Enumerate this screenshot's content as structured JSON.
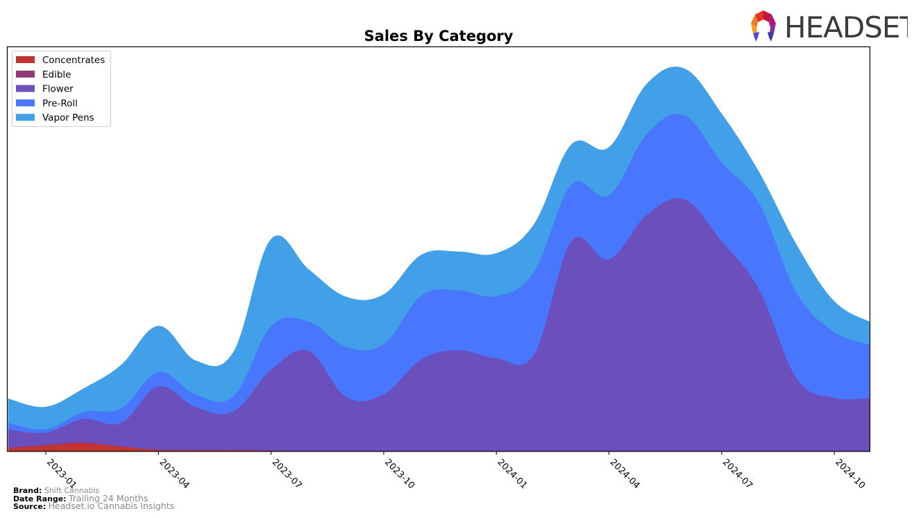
{
  "brand_logo": {
    "text": "HEADSET",
    "icon": "headset-hexagon-logo-icon"
  },
  "footer": {
    "brand_label": "Brand:",
    "brand_value": "Shift Cannabis",
    "date_range_label": "Date Range:",
    "date_range_value": "Trailing 24 Months",
    "source_label": "Source:",
    "source_value": "Headset.io Cannabis Insights"
  },
  "chart_data": {
    "type": "area",
    "stacked": true,
    "title": "Sales By Category",
    "xlabel": "",
    "ylabel": "",
    "y_axis_visible": false,
    "grid": false,
    "legend_position": "top-left",
    "x": [
      "2022-12",
      "2023-01",
      "2023-02",
      "2023-03",
      "2023-04",
      "2023-05",
      "2023-06",
      "2023-07",
      "2023-08",
      "2023-09",
      "2023-10",
      "2023-11",
      "2023-12",
      "2024-01",
      "2024-02",
      "2024-03",
      "2024-04",
      "2024-05",
      "2024-06",
      "2024-07",
      "2024-08",
      "2024-09",
      "2024-10",
      "2024-11"
    ],
    "x_ticks": [
      "2023-01",
      "2023-04",
      "2023-07",
      "2023-10",
      "2024-01",
      "2024-04",
      "2024-07",
      "2024-10"
    ],
    "ylim": [
      0,
      100
    ],
    "series": [
      {
        "name": "Concentrates",
        "color": "#c23431",
        "values": [
          0.8,
          1.5,
          2.1,
          1.2,
          0.4,
          0.3,
          0.3,
          0.2,
          0.1,
          0.1,
          0.1,
          0.1,
          0.1,
          0.1,
          0.1,
          0.1,
          0.1,
          0.1,
          0.1,
          0.1,
          0.1,
          0.1,
          0.1,
          0.1
        ]
      },
      {
        "name": "Edible",
        "color": "#8e3b78",
        "values": [
          0.2,
          0.2,
          0.2,
          0.1,
          0.1,
          0.1,
          0.1,
          0.1,
          0.0,
          0.0,
          0.0,
          0.0,
          0.0,
          0.0,
          0.0,
          0.0,
          0.0,
          0.0,
          0.0,
          0.0,
          0.0,
          0.0,
          0.0,
          0.0
        ]
      },
      {
        "name": "Flower",
        "color": "#6a4fbd",
        "values": [
          4.5,
          3.0,
          5.8,
          5.8,
          15.6,
          10.6,
          9.6,
          20.0,
          24.8,
          13.4,
          14.1,
          22.7,
          25.0,
          23.0,
          24.0,
          52.0,
          47.5,
          58.4,
          62.3,
          52.0,
          40.0,
          18.0,
          13.2,
          13.2
        ]
      },
      {
        "name": "Pre-Roll",
        "color": "#4877fd",
        "values": [
          1.6,
          0.8,
          1.7,
          3.6,
          3.6,
          3.1,
          3.8,
          10.7,
          7.3,
          12.4,
          12.4,
          15.8,
          14.8,
          15.4,
          20.4,
          14.0,
          15.8,
          20.0,
          20.8,
          19.5,
          21.3,
          21.2,
          16.3,
          13.0
        ]
      },
      {
        "name": "Vapor Pens",
        "color": "#41a0e8",
        "values": [
          5.9,
          5.5,
          5.7,
          10.6,
          11.3,
          8.3,
          10.8,
          21.5,
          12.8,
          12.3,
          12.2,
          10.0,
          9.5,
          10.5,
          11.6,
          9.8,
          11.8,
          12.3,
          11.5,
          11.9,
          7.6,
          11.7,
          7.5,
          5.5
        ]
      }
    ]
  }
}
